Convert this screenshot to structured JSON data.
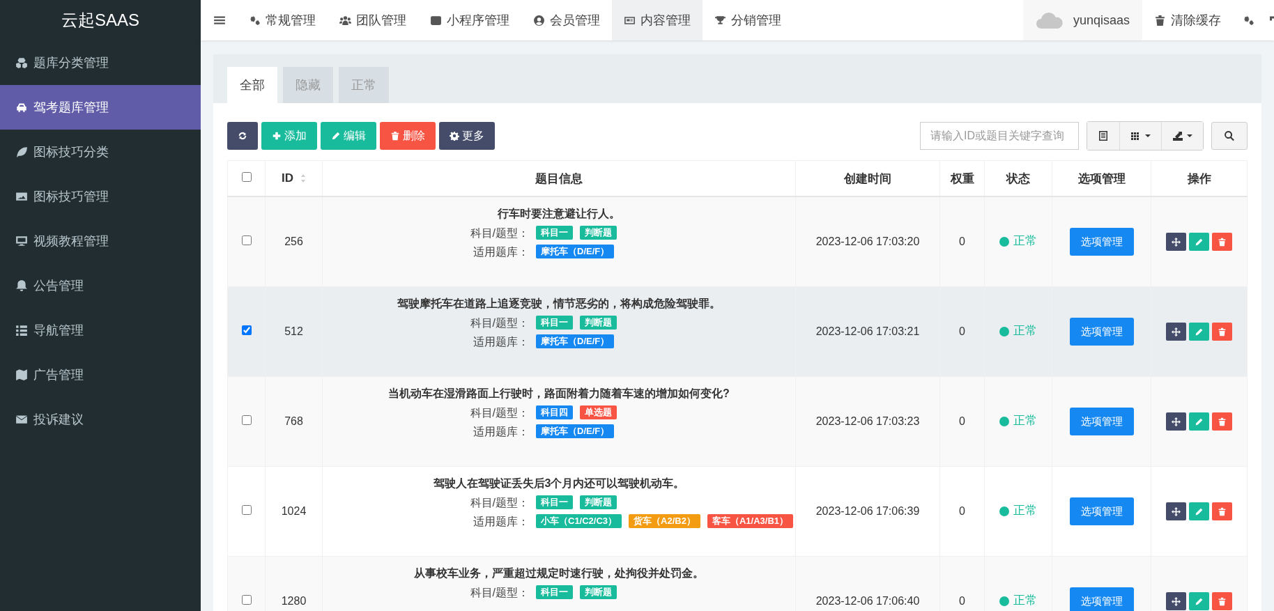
{
  "sidebar": {
    "brand": "云起SAAS",
    "items": [
      {
        "label": "题库分类管理",
        "selected": false
      },
      {
        "label": "驾考题库管理",
        "selected": true
      },
      {
        "label": "图标技巧分类",
        "selected": false
      },
      {
        "label": "图标技巧管理",
        "selected": false
      },
      {
        "label": "视频教程管理",
        "selected": false
      },
      {
        "label": "公告管理",
        "selected": false
      },
      {
        "label": "导航管理",
        "selected": false
      },
      {
        "label": "广告管理",
        "selected": false
      },
      {
        "label": "投诉建议",
        "selected": false
      }
    ]
  },
  "topbar": {
    "nav": [
      {
        "label": "常规管理",
        "selected": false
      },
      {
        "label": "团队管理",
        "selected": false
      },
      {
        "label": "小程序管理",
        "selected": false
      },
      {
        "label": "会员管理",
        "selected": false
      },
      {
        "label": "内容管理",
        "selected": true
      },
      {
        "label": "分销管理",
        "selected": false
      }
    ],
    "user": "yunqisaas",
    "clear_cache": "清除缓存"
  },
  "tabs": [
    {
      "label": "全部",
      "selected": true
    },
    {
      "label": "隐藏",
      "selected": false
    },
    {
      "label": "正常",
      "selected": false
    }
  ],
  "toolbar": {
    "buttons": [
      {
        "kind": "refresh"
      },
      {
        "kind": "add",
        "label": "添加"
      },
      {
        "kind": "edit",
        "label": "编辑"
      },
      {
        "kind": "delete",
        "label": "删除"
      },
      {
        "kind": "more",
        "label": "更多"
      }
    ],
    "search": {
      "placeholder": "请输入ID或题目关键字查询"
    }
  },
  "table": {
    "select_all_checked": false,
    "columns": [
      "ID",
      "题目信息",
      "创建时间",
      "权重",
      "状态",
      "选项管理",
      "操作"
    ],
    "rows": [
      {
        "checked": false,
        "id": "256",
        "title": "行车时要注意避让行人。",
        "subject_label": "科目/题型：",
        "subject_tags": [
          {
            "text": "科目一",
            "color": "#18bc9c"
          },
          {
            "text": "判断题",
            "color": "#18bc9c"
          }
        ],
        "bank_label": "适用题库：",
        "bank_tags": [
          {
            "text": "摩托车（D/E/F）",
            "color": "#1688f1"
          }
        ],
        "created": "2023-12-06 17:03:20",
        "weight": "0",
        "status": "正常",
        "option_button": "选项管理"
      },
      {
        "checked": true,
        "id": "512",
        "title": "驾驶摩托车在道路上追逐竞驶，情节恶劣的，将构成危险驾驶罪。",
        "subject_label": "科目/题型：",
        "subject_tags": [
          {
            "text": "科目一",
            "color": "#18bc9c"
          },
          {
            "text": "判断题",
            "color": "#18bc9c"
          }
        ],
        "bank_label": "适用题库：",
        "bank_tags": [
          {
            "text": "摩托车（D/E/F）",
            "color": "#1688f1"
          }
        ],
        "created": "2023-12-06 17:03:21",
        "weight": "0",
        "status": "正常",
        "option_button": "选项管理"
      },
      {
        "checked": false,
        "id": "768",
        "title": "当机动车在湿滑路面上行驶时，路面附着力随着车速的增加如何变化?",
        "subject_label": "科目/题型：",
        "subject_tags": [
          {
            "text": "科目四",
            "color": "#1688f1"
          },
          {
            "text": "单选题",
            "color": "#f75444"
          }
        ],
        "bank_label": "适用题库：",
        "bank_tags": [
          {
            "text": "摩托车（D/E/F）",
            "color": "#1688f1"
          }
        ],
        "created": "2023-12-06 17:03:23",
        "weight": "0",
        "status": "正常",
        "option_button": "选项管理"
      },
      {
        "checked": false,
        "id": "1024",
        "title": "驾驶人在驾驶证丢失后3个月内还可以驾驶机动车。",
        "subject_label": "科目/题型：",
        "subject_tags": [
          {
            "text": "科目一",
            "color": "#18bc9c"
          },
          {
            "text": "判断题",
            "color": "#18bc9c"
          }
        ],
        "bank_label": "适用题库：",
        "bank_tags": [
          {
            "text": "小车（C1/C2/C3）",
            "color": "#18bc9c"
          },
          {
            "text": "货车（A2/B2）",
            "color": "#f39c12"
          },
          {
            "text": "客车（A1/A3/B1）",
            "color": "#f75444"
          }
        ],
        "created": "2023-12-06 17:06:39",
        "weight": "0",
        "status": "正常",
        "option_button": "选项管理"
      },
      {
        "checked": false,
        "id": "1280",
        "title": "从事校车业务，严重超过规定时速行驶，处拘役并处罚金。",
        "subject_label": "科目/题型：",
        "subject_tags": [
          {
            "text": "科目一",
            "color": "#18bc9c"
          },
          {
            "text": "判断题",
            "color": "#18bc9c"
          }
        ],
        "created": "2023-12-06 17:06:40",
        "weight": "0",
        "status": "正常",
        "option_button": "选项管理"
      }
    ]
  }
}
